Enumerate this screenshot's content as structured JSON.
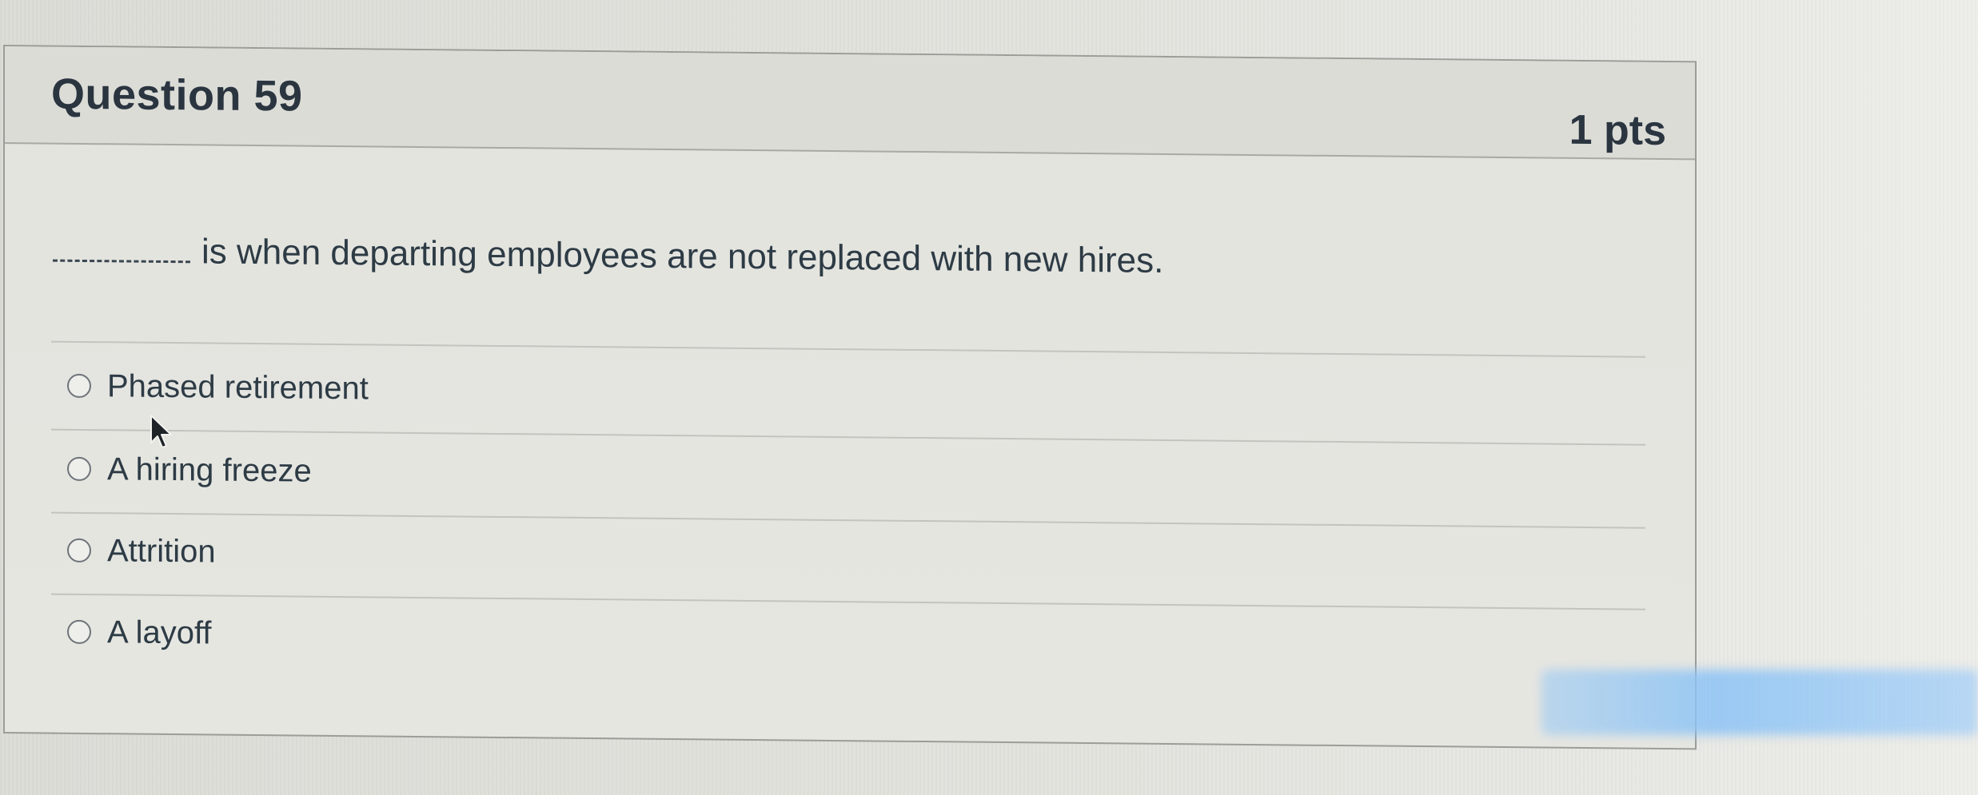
{
  "question": {
    "title": "Question 59",
    "points": "1 pts",
    "text": "is when departing employees are not replaced with new hires."
  },
  "answers": [
    {
      "label": "Phased retirement",
      "selected": false
    },
    {
      "label": "A hiring freeze",
      "selected": false
    },
    {
      "label": "Attrition",
      "selected": false
    },
    {
      "label": "A layoff",
      "selected": false
    }
  ],
  "icons": {
    "cursor": "mouse-pointer-icon",
    "radio": "radio-button-icon"
  },
  "colors": {
    "text": "#2d3b45",
    "border": "#9c9c98",
    "background": "#e2e2dd",
    "header_background": "#dcdcd7"
  }
}
